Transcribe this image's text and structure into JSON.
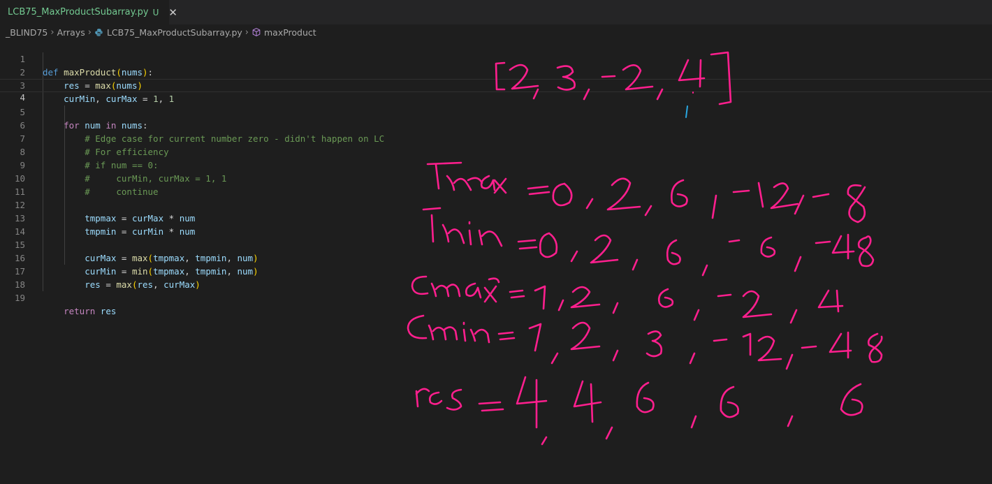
{
  "tab": {
    "filename": "LCB75_MaxProductSubarray.py",
    "status": "U",
    "close_glyph": "✕"
  },
  "breadcrumb": {
    "items": [
      "_BLIND75",
      "Arrays",
      "LCB75_MaxProductSubarray.py",
      "maxProduct"
    ],
    "separator": "›"
  },
  "code": {
    "line_numbers": [
      "1",
      "2",
      "3",
      "4",
      "5",
      "6",
      "7",
      "8",
      "9",
      "10",
      "11",
      "12",
      "13",
      "14",
      "15",
      "16",
      "17",
      "18",
      "19"
    ],
    "current_line": "4",
    "def_kw": "def",
    "func_name": "maxProduct",
    "param": "nums",
    "res": "res",
    "max_fn": "max",
    "min_fn": "min",
    "curMin": "curMin",
    "curMax": "curMax",
    "one": "1",
    "for_kw": "for",
    "in_kw": "in",
    "num": "num",
    "nums": "nums",
    "comment_6": "# Edge case for current number zero - didn't happen on LC",
    "comment_7": "# For efficiency",
    "comment_8": "# if num == 0:",
    "comment_9": "#     curMin, curMax = 1, 1",
    "comment_10": "#     continue",
    "tmpmax": "tmpmax",
    "tmpmin": "tmpmin",
    "return_kw": "return",
    "eq": " = ",
    "times": " * ",
    "comma": ", ",
    "colon": ":",
    "lparen": "(",
    "rparen": ")"
  },
  "colors": {
    "accent_ink": "#ff1f8e",
    "cursor_ink": "#2aa7e0",
    "background": "#1e1e1e"
  },
  "icons": {
    "python_file": "python-icon",
    "symbol_method": "cube-icon",
    "close": "close-icon"
  }
}
